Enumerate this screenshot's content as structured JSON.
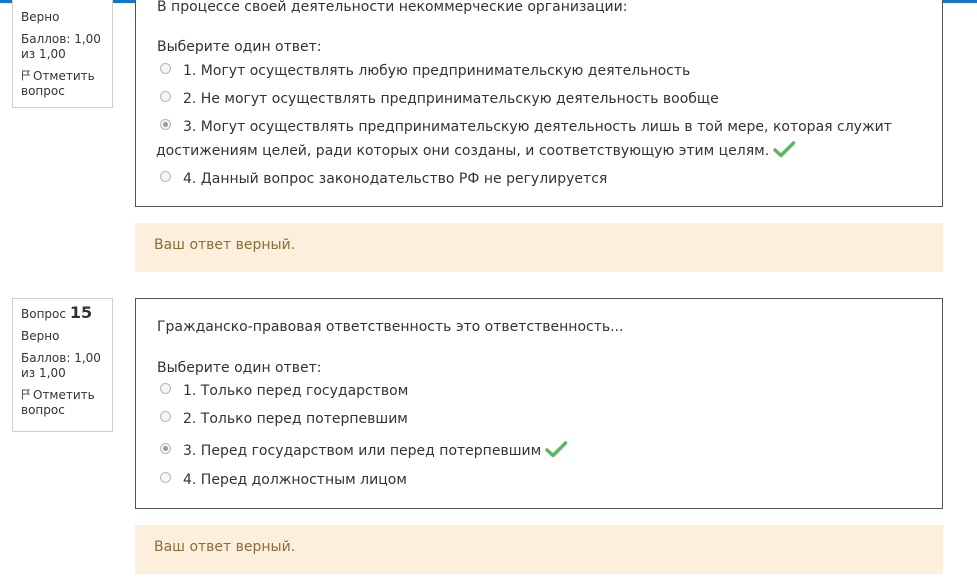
{
  "q14": {
    "state": "Верно",
    "grade": "Баллов: 1,00 из 1,00",
    "flag_label": "Отметить вопрос",
    "question_text": "В процессе своей деятельности некоммерческие организации:",
    "prompt": "Выберите один ответ:",
    "options": [
      {
        "label": "1. Могут осуществлять любую предпринимательскую деятельность"
      },
      {
        "label": "2. Не могут осуществлять предпринимательскую деятельность вообще"
      },
      {
        "label": "3. Могут осуществлять предпринимательскую деятельность лишь в той мере, которая служит",
        "label_cont": "достижениям целей, ради которых они созданы, и соответствующую этим целям."
      },
      {
        "label": "4. Данный вопрос законодательство РФ не регулируется"
      }
    ],
    "selected_index": 2,
    "feedback": "Ваш ответ верный."
  },
  "q15": {
    "label": "Вопрос",
    "number": "15",
    "state": "Верно",
    "grade": "Баллов: 1,00 из 1,00",
    "flag_label": "Отметить вопрос",
    "question_text": "Гражданско-правовая ответственность это ответственность...",
    "prompt": "Выберите один ответ:",
    "options": [
      {
        "label": "1. Только перед государством"
      },
      {
        "label": "2. Только перед потерпевшим"
      },
      {
        "label": "3. Перед государством или перед потерпевшим"
      },
      {
        "label": "4. Перед должностным лицом"
      }
    ],
    "selected_index": 2,
    "feedback": "Ваш ответ верный."
  },
  "colors": {
    "accent_bar": "#1177d1",
    "correct_check": "#5cb85c",
    "feedback_bg": "#fcefdc",
    "feedback_text": "#8a6d3b"
  },
  "icons": {
    "flag": "flag-icon",
    "correct": "check-icon"
  }
}
